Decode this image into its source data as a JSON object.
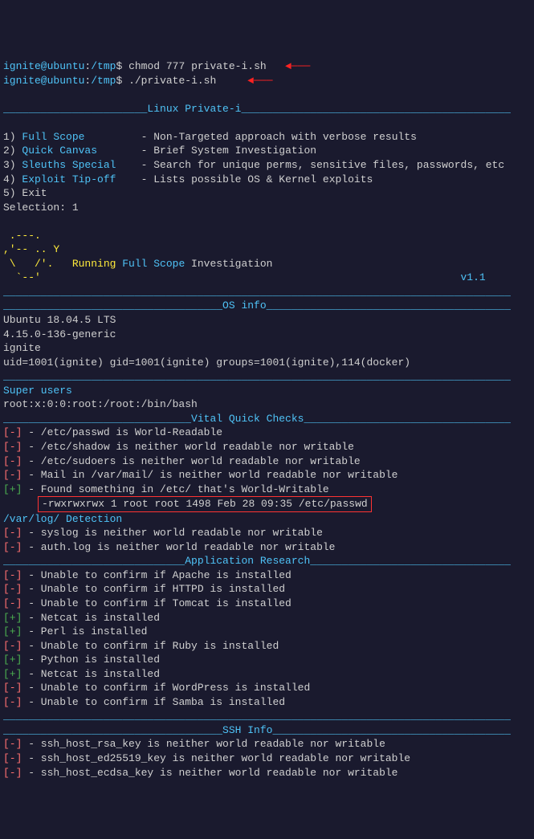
{
  "prompt1": {
    "userhost": "ignite@ubuntu",
    "path": "/tmp",
    "command": "chmod 777 private-i.sh"
  },
  "prompt2": {
    "userhost": "ignite@ubuntu",
    "path": "/tmp",
    "command": "./private-i.sh"
  },
  "title_line": "_______________________Linux Private-i___________________________________________",
  "menu": {
    "items": [
      {
        "num": "1) ",
        "name": "Full Scope",
        "desc": "- Non-Targeted approach with verbose results"
      },
      {
        "num": "2) ",
        "name": "Quick Canvas",
        "desc": "- Brief System Investigation"
      },
      {
        "num": "3) ",
        "name": "Sleuths Special",
        "desc": "- Search for unique perms, sensitive files, passwords, etc"
      },
      {
        "num": "4) ",
        "name": "Exploit Tip-off",
        "desc": "- Lists possible OS & Kernel exploits"
      },
      {
        "num": "5) ",
        "name": "Exit",
        "desc": ""
      }
    ],
    "selection": "Selection: 1"
  },
  "ascii": {
    "l1": " .---.",
    "l2": ",'-- .. ",
    "l2y": "Y",
    "l3": " \\   /'.   Running ",
    "l3b": "Full Scope",
    "l3c": " Investigation",
    "l4": "  `--'"
  },
  "version": "v1.1",
  "sep_line": "_________________________________________________________________________________",
  "os_info": {
    "header": "___________________________________OS info_______________________________________",
    "lines": [
      "Ubuntu 18.04.5 LTS",
      "4.15.0-136-generic",
      "ignite",
      "uid=1001(ignite) gid=1001(ignite) groups=1001(ignite),114(docker)"
    ]
  },
  "super_users": {
    "header": "Super users",
    "line": "root:x:0:0:root:/root:/bin/bash"
  },
  "vital": {
    "header": "______________________________Vital Quick Checks_________________________________",
    "items": [
      {
        "s": "[-]",
        "t": " - /etc/passwd is World-Readable"
      },
      {
        "s": "[-]",
        "t": " - /etc/shadow is neither world readable nor writable"
      },
      {
        "s": "[-]",
        "t": " - /etc/sudoers is neither world readable nor writable"
      },
      {
        "s": "[-]",
        "t": " - Mail in /var/mail/ is neither world readable nor writable"
      },
      {
        "s": "[+]",
        "t": " - Found something in /etc/ that's World-Writable"
      }
    ],
    "boxed": "-rwxrwxrwx 1 root root 1498 Feb 28 09:35 /etc/passwd"
  },
  "varlog": {
    "header": "/var/log/ Detection",
    "items": [
      {
        "s": "[-]",
        "t": " - syslog is neither world readable nor writable"
      },
      {
        "s": "[-]",
        "t": " - auth.log is neither world readable nor writable"
      }
    ]
  },
  "app_research": {
    "header": "_____________________________Application Research________________________________",
    "items": [
      {
        "s": "[-]",
        "t": " - Unable to confirm if Apache is installed"
      },
      {
        "s": "[-]",
        "t": " - Unable to confirm if HTTPD is installed"
      },
      {
        "s": "[-]",
        "t": " - Unable to confirm if Tomcat is installed"
      },
      {
        "s": "[+]",
        "t": " - Netcat is installed"
      },
      {
        "s": "[+]",
        "t": " - Perl is installed"
      },
      {
        "s": "[-]",
        "t": " - Unable to confirm if Ruby is installed"
      },
      {
        "s": "[+]",
        "t": " - Python is installed"
      },
      {
        "s": "[+]",
        "t": " - Netcat is installed"
      },
      {
        "s": "[-]",
        "t": " - Unable to confirm if WordPress is installed"
      },
      {
        "s": "[-]",
        "t": " - Unable to confirm if Samba is installed"
      }
    ]
  },
  "ssh_info": {
    "header": "___________________________________SSH Info______________________________________",
    "items": [
      {
        "s": "[-]",
        "t": " - ssh_host_rsa_key is neither world readable nor writable"
      },
      {
        "s": "[-]",
        "t": " - ssh_host_ed25519_key is neither world readable nor writable"
      },
      {
        "s": "[-]",
        "t": " - ssh_host_ecdsa_key is neither world readable nor writable"
      }
    ]
  }
}
